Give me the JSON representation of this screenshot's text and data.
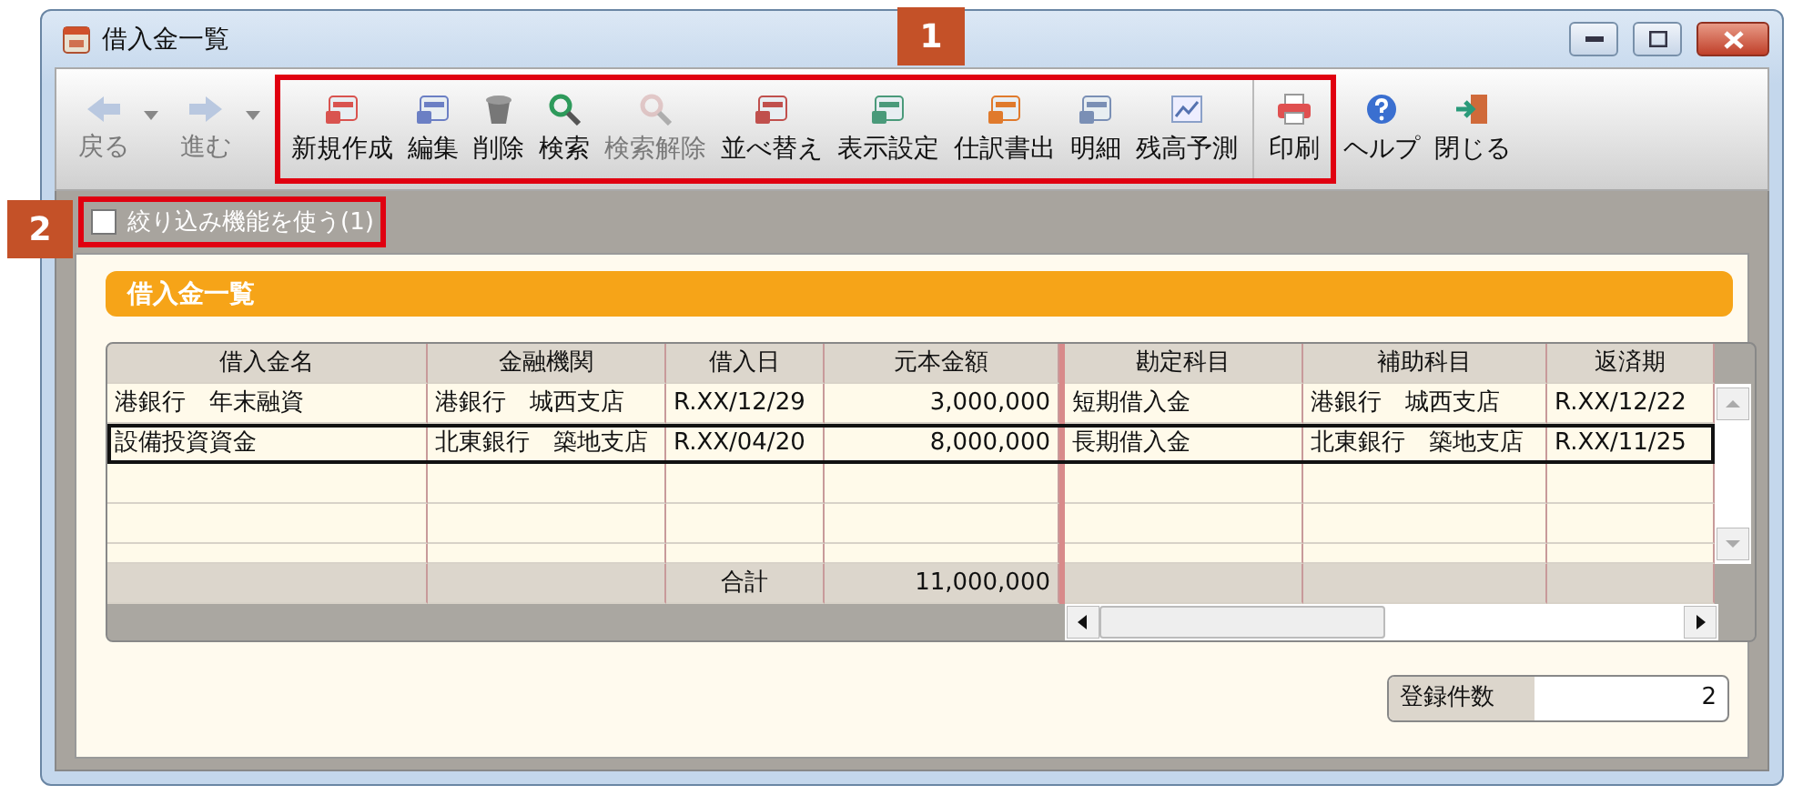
{
  "window": {
    "title": "借入金一覧"
  },
  "toolbar": {
    "nav": [
      {
        "label": "戻る",
        "disabled": true
      },
      {
        "label": "進む",
        "disabled": true
      }
    ],
    "main": [
      {
        "label": "新規作成",
        "disabled": false
      },
      {
        "label": "編集",
        "disabled": false
      },
      {
        "label": "削除",
        "disabled": false
      },
      {
        "label": "検索",
        "disabled": false
      },
      {
        "label": "検索解除",
        "disabled": true
      },
      {
        "label": "並べ替え",
        "disabled": false
      },
      {
        "label": "表示設定",
        "disabled": false
      },
      {
        "label": "仕訳書出",
        "disabled": false
      },
      {
        "label": "明細",
        "disabled": false
      },
      {
        "label": "残高予測",
        "disabled": false
      }
    ],
    "print": {
      "label": "印刷"
    },
    "extra": [
      {
        "label": "ヘルプ"
      },
      {
        "label": "閉じる"
      }
    ]
  },
  "filter": {
    "label": "絞り込み機能を使う(1)",
    "checked": false
  },
  "panel": {
    "title": "借入金一覧"
  },
  "table": {
    "columns": [
      "借入金名",
      "金融機関",
      "借入日",
      "元本金額",
      "勘定科目",
      "補助科目",
      "返済期"
    ],
    "rows": [
      {
        "cells": [
          "港銀行　年末融資",
          "港銀行　城西支店",
          "R.XX/12/29",
          "3,000,000",
          "短期借入金",
          "港銀行　城西支店",
          "R.XX/12/22"
        ],
        "selected": false
      },
      {
        "cells": [
          "設備投資資金",
          "北東銀行　築地支店",
          "R.XX/04/20",
          "8,000,000",
          "長期借入金",
          "北東銀行　築地支店",
          "R.XX/11/25"
        ],
        "selected": true
      }
    ],
    "total": {
      "label": "合計",
      "amount": "11,000,000"
    }
  },
  "count": {
    "label": "登録件数",
    "value": "2"
  },
  "callouts": [
    {
      "number": "1"
    },
    {
      "number": "2"
    }
  ]
}
